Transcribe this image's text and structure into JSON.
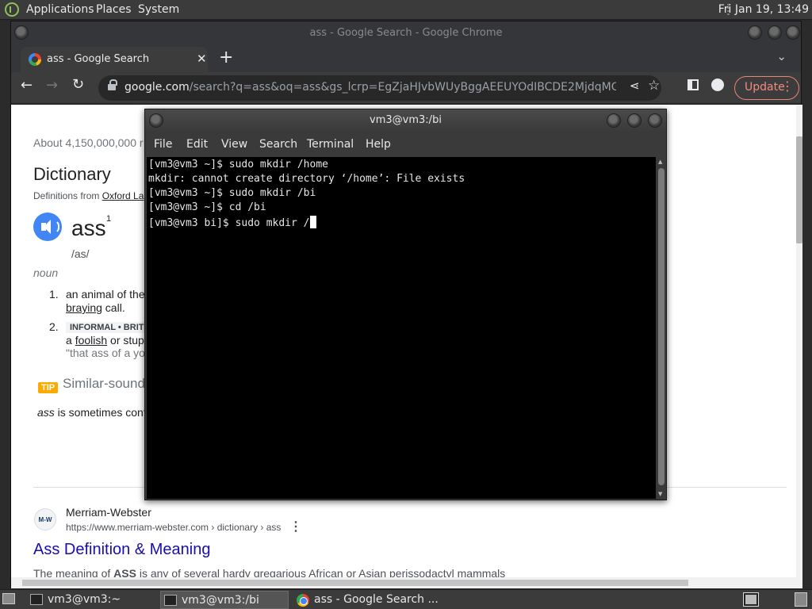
{
  "top_panel": {
    "menus": [
      "Applications",
      "Places",
      "System"
    ],
    "clock": "Fri Jan 19, 13:49"
  },
  "chrome": {
    "window_title": "ass - Google Search - Google Chrome",
    "tab_title": "ass - Google Search",
    "url_host": "google.com",
    "url_rest": "/search?q=ass&oq=ass&gs_lcrp=EgZjaHJvbWUyBggAEEUYOdIBCDE2MjdqMGo3qAIAs…",
    "update_label": "Update"
  },
  "page": {
    "result_stats": "About 4,150,000,000 r",
    "dictionary_heading": "Dictionary",
    "definitions_from": "Definitions from ",
    "definitions_source": "Oxford La",
    "word": "ass",
    "word_superscript": "1",
    "phonetic": "/as/",
    "part_of_speech": "noun",
    "def1_number": "1.",
    "def1_text": "an animal of the",
    "def1_link": "braying",
    "def1_tail": " call.",
    "def2_number": "2.",
    "def2_tag": "INFORMAL • BRIT",
    "def2_prefix": "a ",
    "def2_link": "foolish",
    "def2_tail": " or stup",
    "def2_example": "\"that ass of a yo",
    "tip_badge": "TIP",
    "tip_heading": "Similar-sound",
    "tip_word": "ass",
    "tip_text": " is sometimes conf",
    "mw_logo": "M-W",
    "mw_name": "Merriam-Webster",
    "mw_url": "https://www.merriam-webster.com › dictionary › ass",
    "mw_title": "Ass Definition & Meaning",
    "mw_snippet_prefix": "The meaning of ",
    "mw_snippet_bold": "ASS",
    "mw_snippet_tail": " is any of several hardy gregarious African or Asian perissodactyl mammals"
  },
  "terminal": {
    "title": "vm3@vm3:/bi",
    "menus": [
      "File",
      "Edit",
      "View",
      "Search",
      "Terminal",
      "Help"
    ],
    "lines": [
      "[vm3@vm3 ~]$ sudo mkdir /home",
      "mkdir: cannot create directory ‘/home’: File exists",
      "[vm3@vm3 ~]$ sudo mkdir /bi",
      "[vm3@vm3 ~]$ cd /bi",
      "[vm3@vm3 bi]$ sudo mkdir /"
    ]
  },
  "taskbar": {
    "tasks": [
      "vm3@vm3:~",
      "vm3@vm3:/bi",
      "ass - Google Search ..."
    ]
  }
}
